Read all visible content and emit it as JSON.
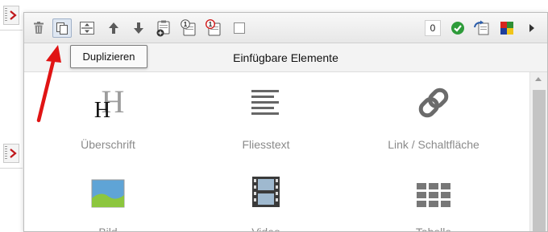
{
  "toolbar": {
    "counter_value": "0",
    "buttons": [
      {
        "name": "delete",
        "icon": "trash-icon"
      },
      {
        "name": "duplicate",
        "icon": "duplicate-icon",
        "active": true
      },
      {
        "name": "expand",
        "icon": "expand-icon"
      },
      {
        "name": "move-up",
        "icon": "arrow-up-icon"
      },
      {
        "name": "move-down",
        "icon": "arrow-down-icon"
      },
      {
        "name": "paste",
        "icon": "clipboard-add-icon"
      },
      {
        "name": "paste-one",
        "icon": "clipboard-1-icon",
        "badge": "1"
      },
      {
        "name": "paste-one-alt",
        "icon": "clipboard-1-red-icon",
        "badge": "1"
      },
      {
        "name": "select",
        "icon": "checkbox-icon"
      }
    ],
    "right_icons": [
      "check-circle-icon",
      "swap-icon",
      "color-grid-icon",
      "play-right-icon"
    ]
  },
  "tooltip": {
    "text": "Duplizieren"
  },
  "subbar": {
    "title": "Einfügbare Elemente"
  },
  "elements": [
    {
      "label": "Überschrift",
      "icon": "heading-icon"
    },
    {
      "label": "Fliesstext",
      "icon": "paragraph-icon"
    },
    {
      "label": "Link / Schaltfläche",
      "icon": "link-icon"
    },
    {
      "label": "Bild",
      "icon": "image-icon"
    },
    {
      "label": "Video",
      "icon": "film-icon"
    },
    {
      "label": "Tabelle",
      "icon": "table-icon"
    }
  ],
  "heading_icon": {
    "glyph": "H"
  },
  "colors": {
    "accent_red": "#d01c1c",
    "check_green": "#2e9b3a",
    "label_gray": "#8a8a8a"
  }
}
